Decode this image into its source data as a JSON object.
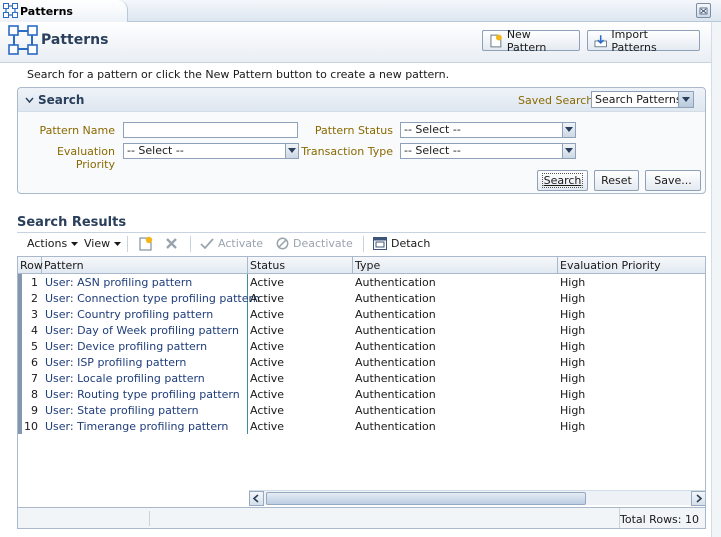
{
  "tab": {
    "label": "Patterns"
  },
  "header": {
    "title": "Patterns",
    "new_pattern_label": "New Pattern",
    "import_patterns_label": "Import Patterns"
  },
  "instructions": "Search for a pattern or click the New Pattern button to create a new pattern.",
  "search": {
    "title": "Search",
    "saved_search_label": "Saved Search",
    "saved_search_value": "Search Patterns",
    "fields": {
      "pattern_name_label": "Pattern Name",
      "pattern_name_value": "",
      "pattern_status_label": "Pattern Status",
      "pattern_status_value": "-- Select --",
      "evaluation_priority_label": "Evaluation Priority",
      "evaluation_priority_value": "-- Select --",
      "transaction_type_label": "Transaction Type",
      "transaction_type_value": "-- Select --"
    },
    "buttons": {
      "search": "Search",
      "reset": "Reset",
      "save": "Save..."
    }
  },
  "results": {
    "title": "Search Results",
    "toolbar": {
      "actions": "Actions",
      "view": "View",
      "activate": "Activate",
      "deactivate": "Deactivate",
      "detach": "Detach"
    },
    "columns": [
      "Row",
      "Pattern",
      "Status",
      "Type",
      "Evaluation Priority"
    ],
    "rows": [
      {
        "row": "1",
        "pattern": "User: ASN profiling pattern",
        "status": "Active",
        "type": "Authentication",
        "priority": "High"
      },
      {
        "row": "2",
        "pattern": "User: Connection type profiling pattern",
        "status": "Active",
        "type": "Authentication",
        "priority": "High"
      },
      {
        "row": "3",
        "pattern": "User: Country profiling pattern",
        "status": "Active",
        "type": "Authentication",
        "priority": "High"
      },
      {
        "row": "4",
        "pattern": "User: Day of Week profiling pattern",
        "status": "Active",
        "type": "Authentication",
        "priority": "High"
      },
      {
        "row": "5",
        "pattern": "User: Device profiling pattern",
        "status": "Active",
        "type": "Authentication",
        "priority": "High"
      },
      {
        "row": "6",
        "pattern": "User: ISP profiling pattern",
        "status": "Active",
        "type": "Authentication",
        "priority": "High"
      },
      {
        "row": "7",
        "pattern": "User: Locale profiling pattern",
        "status": "Active",
        "type": "Authentication",
        "priority": "High"
      },
      {
        "row": "8",
        "pattern": "User: Routing type profiling pattern",
        "status": "Active",
        "type": "Authentication",
        "priority": "High"
      },
      {
        "row": "9",
        "pattern": "User: State profiling pattern",
        "status": "Active",
        "type": "Authentication",
        "priority": "High"
      },
      {
        "row": "10",
        "pattern": "User: Timerange profiling pattern",
        "status": "Active",
        "type": "Authentication",
        "priority": "High"
      }
    ],
    "total_rows": "Total Rows: 10"
  },
  "icons": {
    "tab": "patterns-icon",
    "close": "close-icon",
    "new": "new-document-icon",
    "import": "import-icon",
    "add": "add-row-icon",
    "delete": "delete-icon",
    "activate": "checkmark-icon",
    "deactivate": "prohibit-icon",
    "detach": "detach-icon"
  }
}
